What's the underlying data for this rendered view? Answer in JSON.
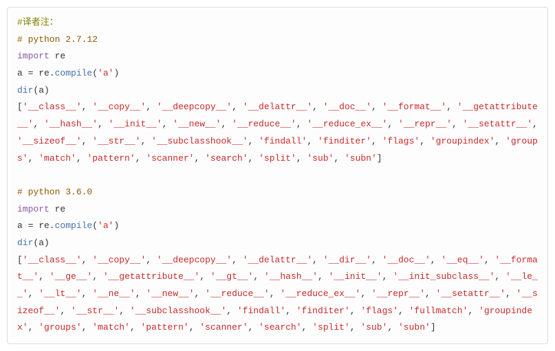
{
  "note": "#译者注：",
  "py2": {
    "comment": "# python 2.7.12",
    "import_kw": "import",
    "import_mod": "re",
    "assign": "a = re.",
    "compile": "compile",
    "compile_arg": "'a'",
    "dir": "dir",
    "dir_arg": "(a)",
    "output": "['__class__', '__copy__', '__deepcopy__', '__delattr__', '__doc__', '__format__', '__getattribute__', '__hash__', '__init__', '__new__', '__reduce__', '__reduce_ex__', '__repr__', '__setattr__', '__sizeof__', '__str__', '__subclasshook__', 'findall', 'finditer', 'flags', 'groupindex', 'groups', 'match', 'pattern', 'scanner', 'search', 'split', 'sub', 'subn']"
  },
  "py3": {
    "comment": "# python 3.6.0",
    "import_kw": "import",
    "import_mod": "re",
    "assign": "a = re.",
    "compile": "compile",
    "compile_arg": "'a'",
    "dir": "dir",
    "dir_arg": "(a)",
    "output": "['__class__', '__copy__', '__deepcopy__', '__delattr__', '__dir__', '__doc__', '__eq__', '__format__', '__ge__', '__getattribute__', '__gt__', '__hash__', '__init__', '__init_subclass__', '__le__', '__lt__', '__ne__', '__new__', '__reduce__', '__reduce_ex__', '__repr__', '__setattr__', '__sizeof__', '__str__', '__subclasshook__', 'findall', 'finditer', 'flags', 'fullmatch', 'groupindex', 'groups', 'match', 'pattern', 'scanner', 'search', 'split', 'sub', 'subn']"
  },
  "chart_data": {
    "type": "table",
    "title": "dir() of compiled regex object — Python 2.7.12 vs 3.6.0",
    "series": [
      {
        "name": "python 2.7.12",
        "values": [
          "__class__",
          "__copy__",
          "__deepcopy__",
          "__delattr__",
          "__doc__",
          "__format__",
          "__getattribute__",
          "__hash__",
          "__init__",
          "__new__",
          "__reduce__",
          "__reduce_ex__",
          "__repr__",
          "__setattr__",
          "__sizeof__",
          "__str__",
          "__subclasshook__",
          "findall",
          "finditer",
          "flags",
          "groupindex",
          "groups",
          "match",
          "pattern",
          "scanner",
          "search",
          "split",
          "sub",
          "subn"
        ]
      },
      {
        "name": "python 3.6.0",
        "values": [
          "__class__",
          "__copy__",
          "__deepcopy__",
          "__delattr__",
          "__dir__",
          "__doc__",
          "__eq__",
          "__format__",
          "__ge__",
          "__getattribute__",
          "__gt__",
          "__hash__",
          "__init__",
          "__init_subclass__",
          "__le__",
          "__lt__",
          "__ne__",
          "__new__",
          "__reduce__",
          "__reduce_ex__",
          "__repr__",
          "__setattr__",
          "__sizeof__",
          "__str__",
          "__subclasshook__",
          "findall",
          "finditer",
          "flags",
          "fullmatch",
          "groupindex",
          "groups",
          "match",
          "pattern",
          "scanner",
          "search",
          "split",
          "sub",
          "subn"
        ]
      }
    ]
  }
}
